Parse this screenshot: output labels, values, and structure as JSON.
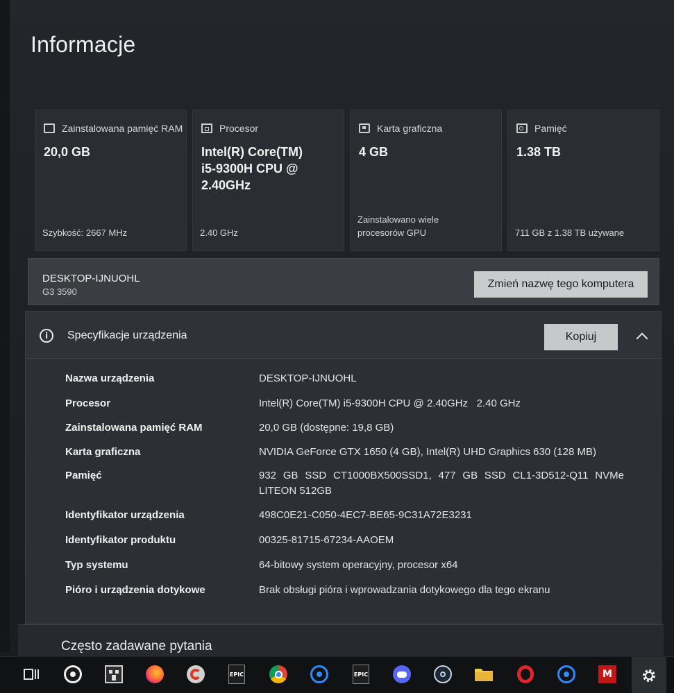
{
  "page": {
    "title": "Informacje"
  },
  "cards": [
    {
      "icon": "ram-icon",
      "label": "Zainstalowana pamięć RAM",
      "value": "20,0 GB",
      "footer": "Szybkość: 2667 MHz"
    },
    {
      "icon": "processor-icon",
      "label": "Procesor",
      "value": "Intel(R) Core(TM) i5-9300H CPU @ 2.40GHz",
      "footer": "2.40 GHz"
    },
    {
      "icon": "graphics-card-icon",
      "label": "Karta graficzna",
      "value": "4 GB",
      "footer": "Zainstalowano wiele procesorów GPU"
    },
    {
      "icon": "storage-icon",
      "label": "Pamięć",
      "value": "1.38 TB",
      "footer": "711 GB z 1.38 TB używane"
    }
  ],
  "device": {
    "name": "DESKTOP-IJNUOHL",
    "model": "G3 3590",
    "rename_label": "Zmień nazwę tego komputera"
  },
  "specs": {
    "title": "Specyfikacje urządzenia",
    "copy_label": "Kopiuj",
    "rows": [
      {
        "key": "Nazwa urządzenia",
        "value": "DESKTOP-IJNUOHL"
      },
      {
        "key": "Procesor",
        "value": "Intel(R) Core(TM) i5-9300H CPU @ 2.40GHz   2.40 GHz"
      },
      {
        "key": "Zainstalowana pamięć RAM",
        "value": "20,0 GB (dostępne: 19,8 GB)"
      },
      {
        "key": "Karta graficzna",
        "value": "NVIDIA GeForce GTX 1650 (4 GB), Intel(R) UHD Graphics 630 (128 MB)"
      },
      {
        "key": "Pamięć",
        "value": "932 GB SSD CT1000BX500SSD1, 477 GB SSD CL1-3D512-Q11 NVMe LITEON 512GB"
      },
      {
        "key": "Identyfikator urządzenia",
        "value": "498C0E21-C050-4EC7-BE65-9C31A72E3231"
      },
      {
        "key": "Identyfikator produktu",
        "value": "00325-81715-67234-AAOEM"
      },
      {
        "key": "Typ systemu",
        "value": "64-bitowy system operacyjny, procesor x64"
      },
      {
        "key": "Pióro i urządzenia dotykowe",
        "value": "Brak obsługi pióra i wprowadzania dotykowego dla tego ekranu"
      }
    ]
  },
  "faq": {
    "title": "Często zadawane pytania"
  },
  "taskbar": {
    "apps": [
      {
        "icon": "task-view-icon"
      },
      {
        "icon": "steelseries-icon"
      },
      {
        "icon": "minecraft-icon"
      },
      {
        "icon": "firefox-icon"
      },
      {
        "icon": "ccleaner-icon"
      },
      {
        "icon": "epic-games-icon",
        "label": "EPIC"
      },
      {
        "icon": "chrome-icon"
      },
      {
        "icon": "battlenet-icon"
      },
      {
        "icon": "epic-games-icon",
        "label": "EPIC"
      },
      {
        "icon": "discord-icon"
      },
      {
        "icon": "steam-icon"
      },
      {
        "icon": "file-explorer-icon"
      },
      {
        "icon": "opera-icon"
      },
      {
        "icon": "battlenet-icon"
      },
      {
        "icon": "mcafee-icon"
      },
      {
        "icon": "settings-gear-icon"
      }
    ]
  }
}
